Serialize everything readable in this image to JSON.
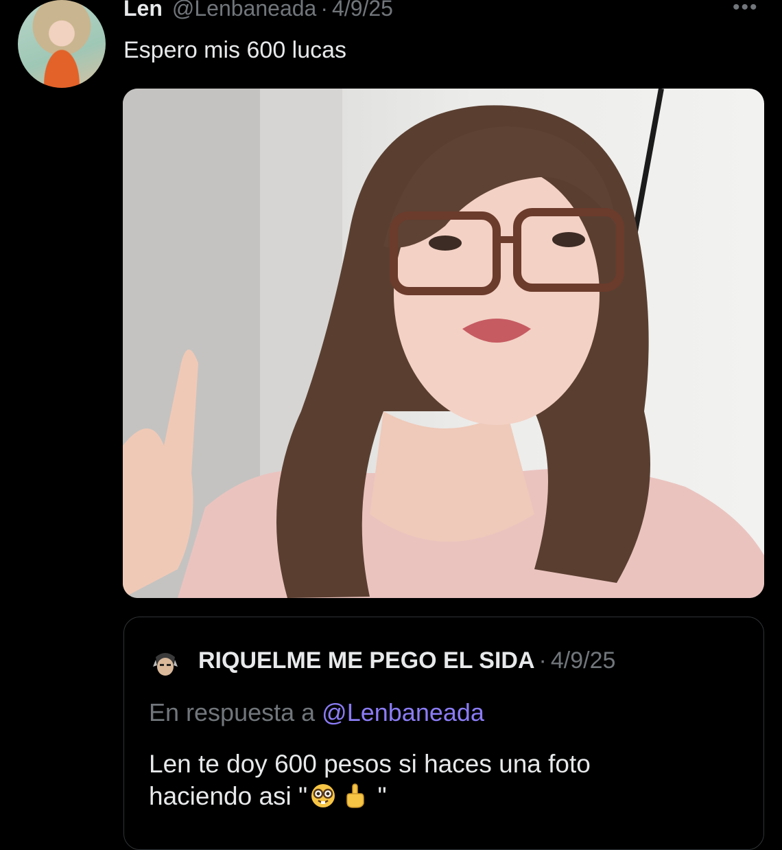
{
  "tweet": {
    "author_name": "Len",
    "handle": "@Lenbaneada",
    "separator": "·",
    "date": "4/9/25",
    "text": "Espero mis 600 lucas",
    "more_icon": "ellipsis-icon",
    "media": {
      "type": "photo",
      "subject": "selfie"
    }
  },
  "quote": {
    "author_name": "RIQUELME ME PEGO EL SIDA",
    "separator": "·",
    "date": "4/9/25",
    "reply_prefix": "En respuesta a",
    "reply_mention": "@Lenbaneada",
    "body_line1": "Len te doy 600 pesos si haces una foto",
    "body_line2_prefix": "haciendo asi \"",
    "body_line2_suffix": " \"",
    "emojis": [
      "nerd-face-emoji",
      "index-pointing-up-emoji"
    ]
  },
  "colors": {
    "background": "#000000",
    "text_primary": "#e7e9ea",
    "text_secondary": "#71767b",
    "mention": "#8b7cf6",
    "border": "#2f3336"
  }
}
